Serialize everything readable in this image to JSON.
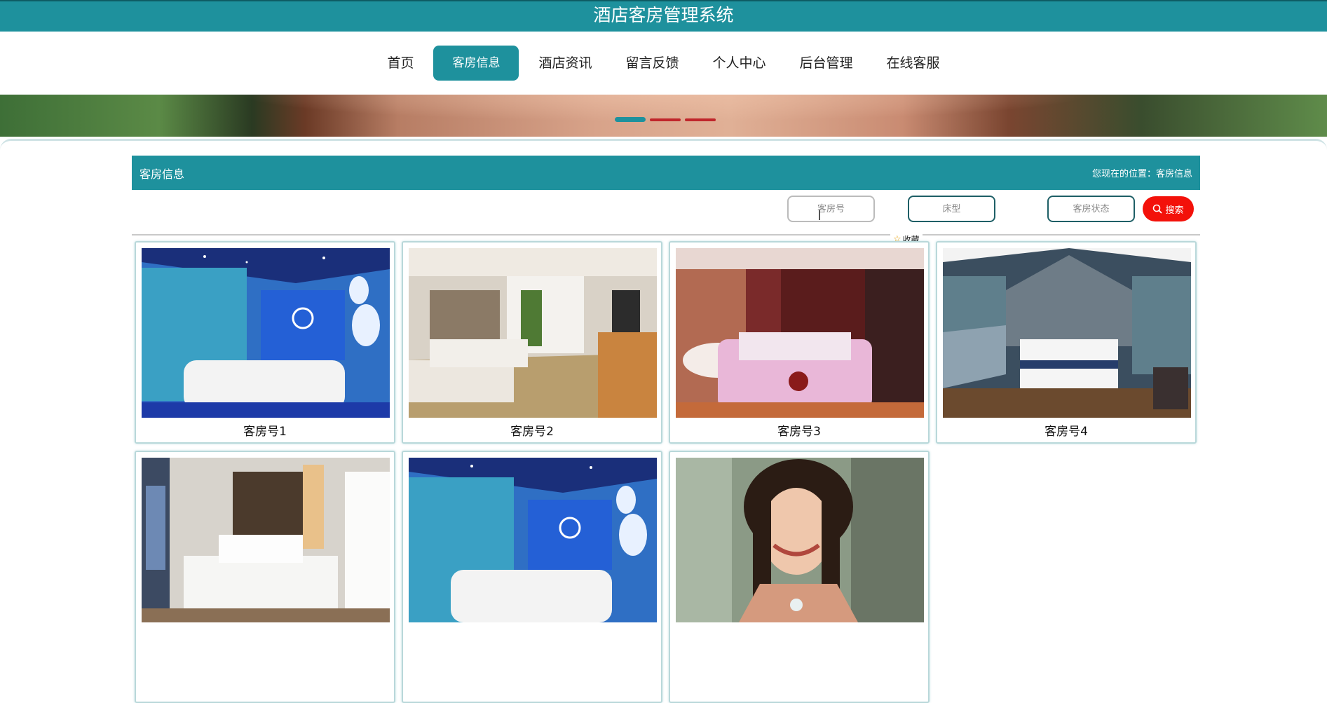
{
  "header": {
    "title": "酒店客房管理系统"
  },
  "nav": {
    "items": [
      {
        "label": "首页"
      },
      {
        "label": "客房信息",
        "active": true
      },
      {
        "label": "酒店资讯"
      },
      {
        "label": "留言反馈"
      },
      {
        "label": "个人中心"
      },
      {
        "label": "后台管理"
      },
      {
        "label": "在线客服"
      }
    ]
  },
  "banner": {
    "slide_count": 3,
    "active_slide": 1
  },
  "section": {
    "title": "客房信息",
    "breadcrumb": "您现在的位置：客房信息"
  },
  "search": {
    "room_number_placeholder": "客房号",
    "bed_type_placeholder": "床型",
    "room_status_placeholder": "客房状态",
    "button_label": "搜索"
  },
  "favorite": {
    "label": "收藏"
  },
  "rooms": [
    {
      "name": "客房号1",
      "image": "ocean-theme-room-photo"
    },
    {
      "name": "客房号2",
      "image": "twin-bed-suite-photo"
    },
    {
      "name": "客房号3",
      "image": "romantic-room-photo"
    },
    {
      "name": "客房号4",
      "image": "river-view-room-photo"
    },
    {
      "name": "",
      "image": "modern-city-view-room-photo"
    },
    {
      "name": "",
      "image": "ocean-theme-room-photo"
    },
    {
      "name": "",
      "image": "woman-portrait-photo"
    }
  ],
  "colors": {
    "primary": "#1e919d",
    "search_button": "#f3110a",
    "slider_inactive": "#c0262b"
  }
}
